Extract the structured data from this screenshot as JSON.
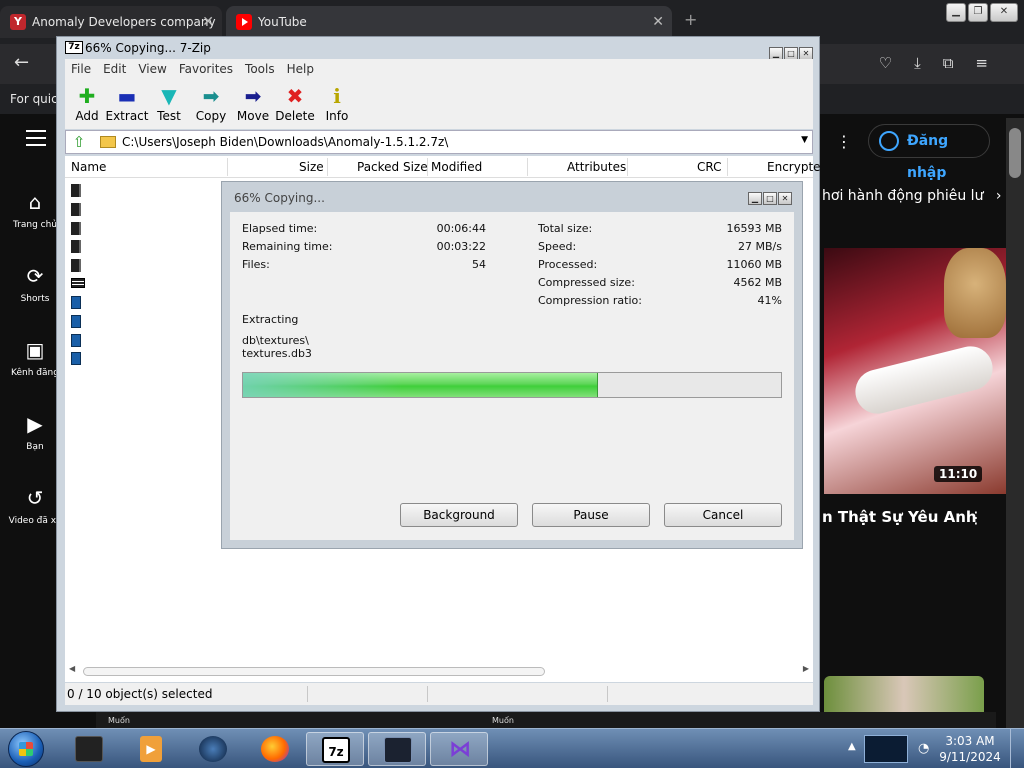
{
  "browser": {
    "tabs": [
      {
        "title": "Anomaly Developers company",
        "favicon": "moddb-favicon"
      },
      {
        "title": "YouTube",
        "favicon": "youtube-favicon"
      }
    ],
    "bookmarks_text": "For quick"
  },
  "youtube": {
    "sidebar": [
      {
        "label": "Trang chủ",
        "icon": "home-icon"
      },
      {
        "label": "Shorts",
        "icon": "shorts-icon"
      },
      {
        "label": "Kênh đăng",
        "icon": "subscriptions-icon"
      },
      {
        "label": "Bạn",
        "icon": "you-icon"
      },
      {
        "label": "Video đã xe",
        "icon": "history-icon"
      }
    ],
    "signin_label": "Đăng nhập",
    "chip_text": "hơi hành động phiêu lư",
    "video_duration": "11:10",
    "video_title": "n Thật Sự Yêu Anh",
    "strip_text_1": "Muốn",
    "strip_text_2": "Muốn"
  },
  "sevenzip": {
    "title": "66% Copying... 7-Zip",
    "menu": [
      "File",
      "Edit",
      "View",
      "Favorites",
      "Tools",
      "Help"
    ],
    "toolbar": [
      {
        "label": "Add",
        "icon": "add-icon",
        "glyph": "✚",
        "color": "#1fae1f"
      },
      {
        "label": "Extract",
        "icon": "extract-icon",
        "glyph": "▬",
        "color": "#1a2fb5"
      },
      {
        "label": "Test",
        "icon": "test-icon",
        "glyph": "▼",
        "color": "#1ab7b7"
      },
      {
        "label": "Copy",
        "icon": "copy-icon",
        "glyph": "➡",
        "color": "#1a8f8f"
      },
      {
        "label": "Move",
        "icon": "move-icon",
        "glyph": "➡",
        "color": "#1a1f8f"
      },
      {
        "label": "Delete",
        "icon": "delete-icon",
        "glyph": "✖",
        "color": "#e02020"
      },
      {
        "label": "Info",
        "icon": "info-icon",
        "glyph": "i",
        "color": "#b8a600"
      }
    ],
    "address": "C:\\Users\\Joseph Biden\\Downloads\\Anomaly-1.5.1.2.7z\\",
    "columns": [
      "Name",
      "Size",
      "Packed Size",
      "Modified",
      "Attributes",
      "CRC",
      "Encrypte"
    ],
    "status": "0 / 10 object(s) selected"
  },
  "progress": {
    "title": "66% Copying...",
    "elapsed_label": "Elapsed time:",
    "elapsed": "00:06:44",
    "remaining_label": "Remaining time:",
    "remaining": "00:03:22",
    "files_label": "Files:",
    "files": "54",
    "total_size_label": "Total size:",
    "total_size": "16593 MB",
    "speed_label": "Speed:",
    "speed": "27 MB/s",
    "processed_label": "Processed:",
    "processed": "11060 MB",
    "compressed_size_label": "Compressed size:",
    "compressed_size": "4562 MB",
    "compression_ratio_label": "Compression ratio:",
    "compression_ratio": "41%",
    "operation": "Extracting",
    "path_line1": "db\\textures\\",
    "path_line2": "textures.db3",
    "progress_fraction": 0.66,
    "background_label": "Background",
    "pause_label": "Pause",
    "cancel_label": "Cancel"
  },
  "taskbar": {
    "apps": [
      {
        "name": "taskbar-app-media",
        "icon": "media-icon"
      },
      {
        "name": "taskbar-app-vlc",
        "icon": "vlc-icon"
      },
      {
        "name": "taskbar-app-globe",
        "icon": "globe-icon"
      },
      {
        "name": "taskbar-app-firefox",
        "icon": "firefox-icon"
      },
      {
        "name": "taskbar-app-7zip",
        "icon": "7zip-icon",
        "label": "7z"
      },
      {
        "name": "taskbar-app-monitor",
        "icon": "monitor-icon"
      },
      {
        "name": "taskbar-app-visual-studio",
        "icon": "visual-studio-icon"
      }
    ],
    "time": "3:03 AM",
    "date": "9/11/2024"
  }
}
